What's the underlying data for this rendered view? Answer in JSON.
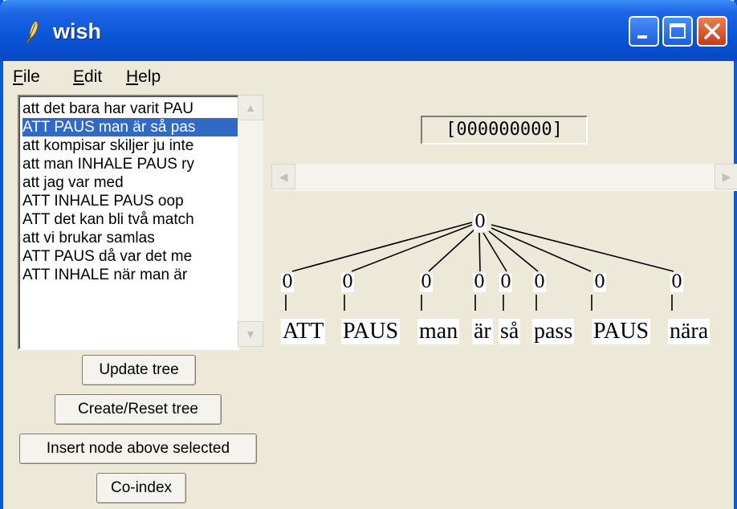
{
  "window": {
    "title": "wish"
  },
  "titlebar_buttons": {
    "minimize": "minimize-icon",
    "maximize": "maximize-icon",
    "close": "close-icon"
  },
  "menu": [
    {
      "label": "File",
      "underline": "F",
      "rest": "ile"
    },
    {
      "label": "Edit",
      "underline": "E",
      "rest": "dit"
    },
    {
      "label": "Help",
      "underline": "H",
      "rest": "elp"
    }
  ],
  "sentence_list": {
    "items": [
      "att det bara har varit PAU",
      "ATT PAUS man är så pas",
      "att kompisar skiljer ju inte",
      "att man INHALE PAUS ry",
      "att jag var med",
      "ATT INHALE PAUS oop",
      "ATT det kan bli två match",
      "att vi brukar samlas",
      "ATT PAUS då var det me",
      "ATT INHALE när man är"
    ],
    "selected_index": 1
  },
  "buttons": {
    "update_tree": "Update tree",
    "create_reset_tree": "Create/Reset tree",
    "insert_node": "Insert node above selected",
    "co_index": "Co-index"
  },
  "tree": {
    "index_readout": "[000000000]",
    "root_label": "0",
    "leaf_labels": [
      "0",
      "0",
      "0",
      "0",
      "0",
      "0",
      "0",
      "0"
    ],
    "words": [
      "ATT",
      "PAUS",
      "man",
      "är",
      "så",
      "pass",
      "PAUS",
      "nära"
    ]
  },
  "colors": {
    "selection": "#316ac5",
    "titlebar": "#0a55d8",
    "window_bg": "#ece9d8"
  }
}
